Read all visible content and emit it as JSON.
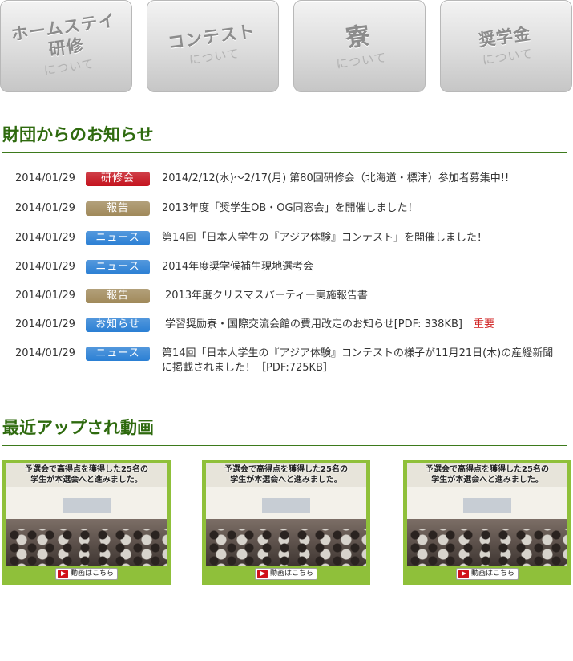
{
  "nav": {
    "tiles": [
      {
        "title_line1": "ホームステイ",
        "title_line2": "研修",
        "sub": "について"
      },
      {
        "title_line1": "コンテスト",
        "title_line2": "",
        "sub": "について"
      },
      {
        "title_line1": "寮",
        "title_line2": "",
        "sub": "について"
      },
      {
        "title_line1": "奨学金",
        "title_line2": "",
        "sub": "について"
      }
    ]
  },
  "news_section": {
    "heading": "財団からのお知らせ",
    "items": [
      {
        "date": "2014/01/29",
        "badge": "研修会",
        "badge_color": "#c4121d",
        "text": "2014/2/12(水)～2/17(月) 第80回研修会（北海道・標津）参加者募集中!!",
        "important": ""
      },
      {
        "date": "2014/01/29",
        "badge": "報告",
        "badge_color": "#a0895a",
        "text": "2013年度「奨学生OB・OG同窓会」を開催しました！",
        "important": ""
      },
      {
        "date": "2014/01/29",
        "badge": "ニュース",
        "badge_color": "#2a7fd4",
        "text": "第14回「日本人学生の『アジア体験』コンテスト」を開催しました！",
        "important": ""
      },
      {
        "date": "2014/01/29",
        "badge": "ニュース",
        "badge_color": "#2a7fd4",
        "text": "2014年度奨学候補生現地選考会",
        "important": ""
      },
      {
        "date": "2014/01/29",
        "badge": "報告",
        "badge_color": "#a0895a",
        "text": "2013年度クリスマスパーティー実施報告書",
        "important": ""
      },
      {
        "date": "2014/01/29",
        "badge": "お知らせ",
        "badge_color": "#2a7fd4",
        "text": "学習奨励寮・国際交流会館の費用改定のお知らせ[PDF: 338KB]",
        "important": "重要"
      },
      {
        "date": "2014/01/29",
        "badge": "ニュース",
        "badge_color": "#2a7fd4",
        "text": "第14回「日本人学生の『アジア体験』コンテストの様子が11月21日(木)の産経新聞に掲載されました！［PDF:725KB］",
        "important": ""
      }
    ]
  },
  "video_section": {
    "heading": "最近アップされ動画",
    "videos": [
      {
        "caption_line1": "予選会で高得点を獲得した25名の",
        "caption_line2": "学生が本選会へと進みました。",
        "button": "動画はこちら"
      },
      {
        "caption_line1": "予選会で高得点を獲得した25名の",
        "caption_line2": "学生が本選会へと進みました。",
        "button": "動画はこちら"
      },
      {
        "caption_line1": "予選会で高得点を獲得した25名の",
        "caption_line2": "学生が本選会へと進みました。",
        "button": "動画はこちら"
      }
    ]
  }
}
